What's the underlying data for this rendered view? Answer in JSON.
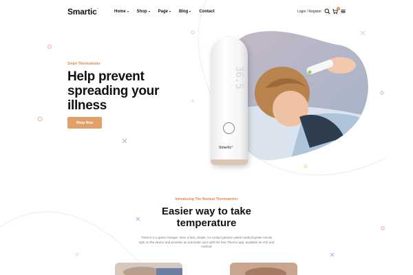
{
  "brand": {
    "name": "Smartic",
    "mark": "°"
  },
  "nav": [
    {
      "label": "Home"
    },
    {
      "label": "Shop"
    },
    {
      "label": "Page"
    },
    {
      "label": "Blog"
    },
    {
      "label": "Contact"
    }
  ],
  "header": {
    "login_label": "Login / Register",
    "cart_count": "0"
  },
  "hero": {
    "eyebrow": "Smart Thermometer",
    "title": "Help prevent spreading your illness",
    "button_label": "Shop Now"
  },
  "device": {
    "screen_text": "36.5",
    "brand": "Smartic°"
  },
  "intro": {
    "label": "Introducing The Nontest Thermometer",
    "title_line1": "Easier way to take",
    "title_line2": "temperature",
    "text": "Thermo is a game changer. Now, a fast, simple, no-contact gesture yields medical-grade results right on the device and provides an automatic sync with the free Thermo app, available for iOS and Android."
  },
  "colors": {
    "accent": "#e8843a",
    "button": "#dfa06a"
  }
}
